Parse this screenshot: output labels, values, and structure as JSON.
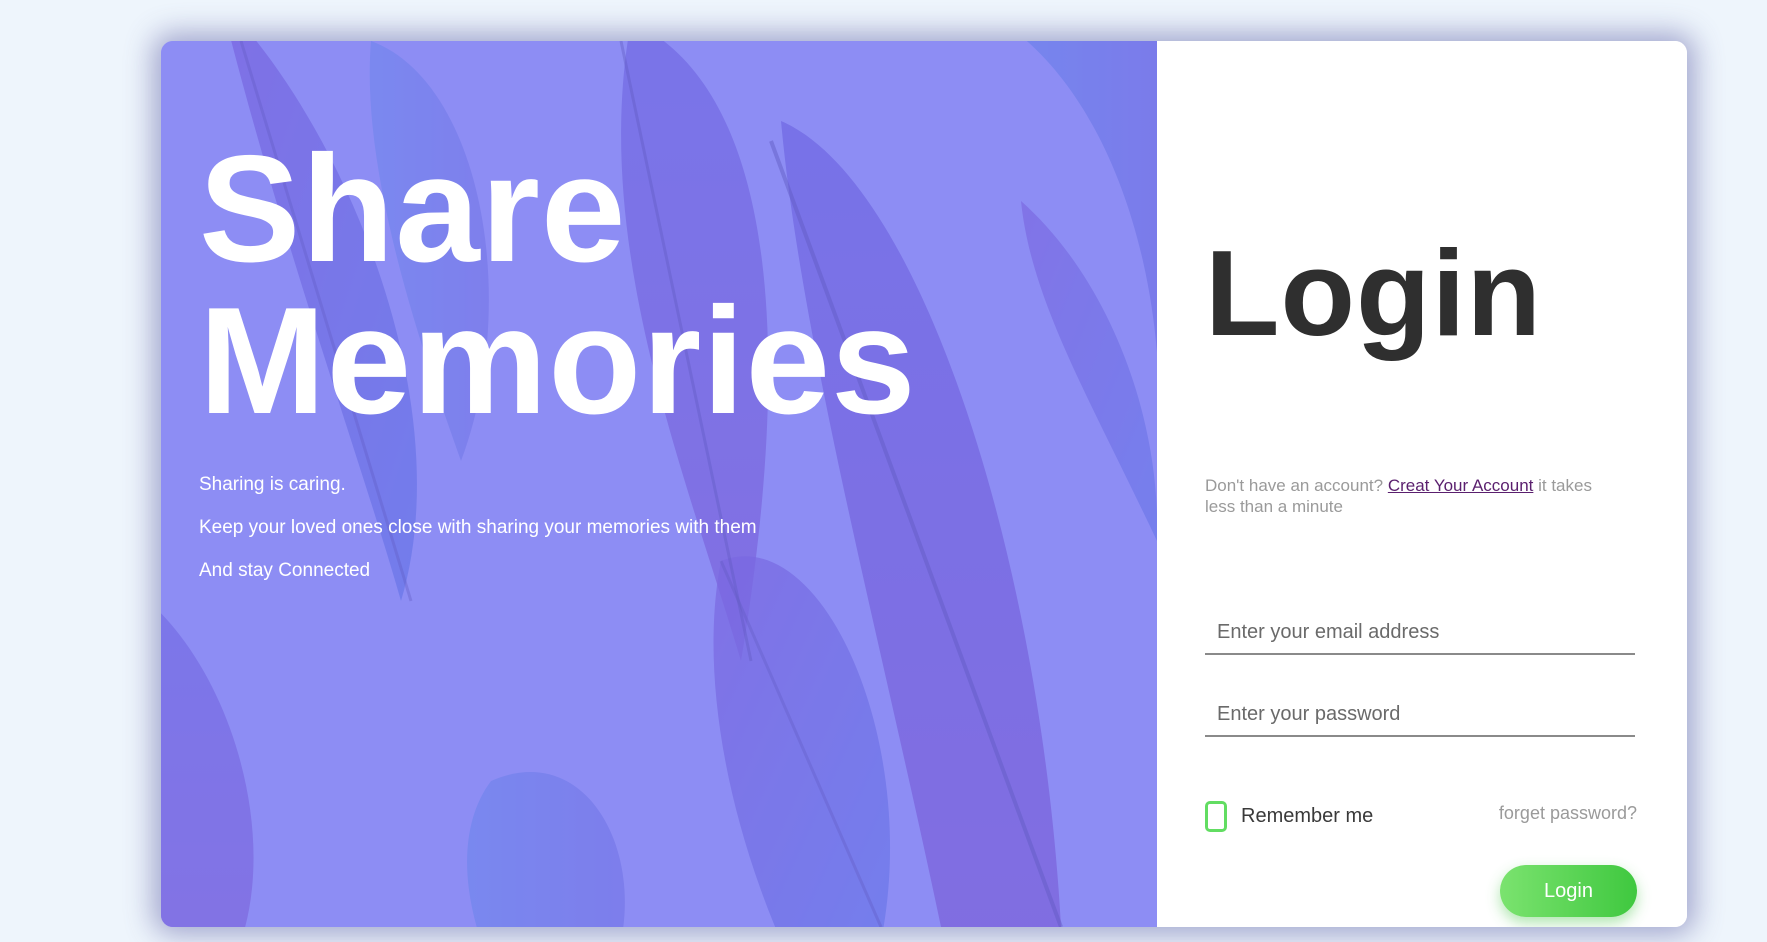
{
  "hero": {
    "title_line1": "Share",
    "title_line2": "Memories",
    "lines": [
      "Sharing is caring.",
      "Keep your loved ones close with sharing your memories with them",
      "And stay Connected"
    ]
  },
  "login": {
    "title": "Login",
    "signup_prefix": "Don't have an account?",
    "signup_link": "Creat Your Account",
    "signup_suffix": "it takes less than a minute",
    "email_placeholder": "Enter your email address",
    "password_placeholder": "Enter your password",
    "remember_label": "Remember me",
    "forgot_label": "forget password?",
    "button_label": "Login"
  },
  "colors": {
    "page_bg": "#eef5fc",
    "hero_tint": "#8a8ff5",
    "accent_green": "#5bd65b",
    "link_purple": "#5a1f6e",
    "title_dark": "#2f2f2f"
  },
  "icons": {
    "remember_checkbox": "checkbox-outline"
  }
}
